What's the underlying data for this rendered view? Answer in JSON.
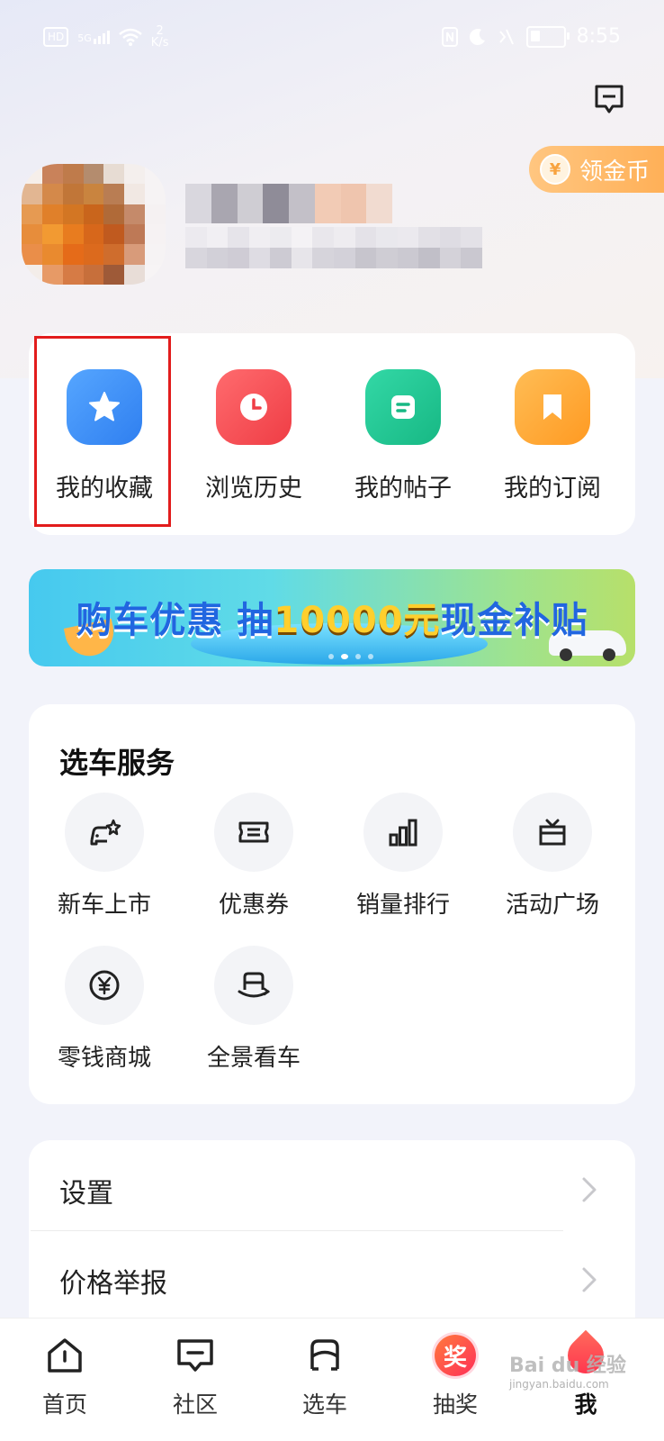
{
  "status_bar": {
    "hd": "HD",
    "net": "5G",
    "speed_value": "2",
    "speed_unit": "K/s",
    "battery": "21",
    "time": "8:55"
  },
  "header": {
    "coin_button_label": "领金币",
    "coin_symbol": "¥"
  },
  "quick_actions": [
    {
      "label": "我的收藏",
      "icon": "star-icon",
      "color": "#3d8ff5"
    },
    {
      "label": "浏览历史",
      "icon": "clock-icon",
      "color": "#f4545a"
    },
    {
      "label": "我的帖子",
      "icon": "post-icon",
      "color": "#22c897"
    },
    {
      "label": "我的订阅",
      "icon": "bookmark-icon",
      "color": "#ffa43a"
    }
  ],
  "banner": {
    "text_part1": "购车优惠 抽",
    "text_highlight": "10000元",
    "text_part2": "现金补贴"
  },
  "services": {
    "title": "选车服务",
    "items": [
      {
        "label": "新车上市",
        "icon": "new-car-icon"
      },
      {
        "label": "优惠券",
        "icon": "coupon-icon"
      },
      {
        "label": "销量排行",
        "icon": "ranking-icon"
      },
      {
        "label": "活动广场",
        "icon": "gift-box-icon"
      },
      {
        "label": "零钱商城",
        "icon": "yuan-coin-icon"
      },
      {
        "label": "全景看车",
        "icon": "panorama-car-icon"
      }
    ]
  },
  "settings": {
    "items": [
      {
        "label": "设置"
      },
      {
        "label": "价格举报"
      }
    ]
  },
  "tabbar": {
    "items": [
      {
        "label": "首页",
        "icon": "home-icon"
      },
      {
        "label": "社区",
        "icon": "community-icon"
      },
      {
        "label": "选车",
        "icon": "car-select-icon"
      },
      {
        "label": "抽奖",
        "icon": "lottery-icon",
        "badge": "奖"
      },
      {
        "label": "我",
        "icon": "me-icon"
      }
    ]
  },
  "watermark": {
    "brand": "Bai du 经验",
    "url": "jingyan.baidu.com"
  },
  "colors": {
    "highlight_box": "#e21c1c",
    "coin_pill": "#ffad52",
    "page_bg": "#f2f3fa"
  }
}
